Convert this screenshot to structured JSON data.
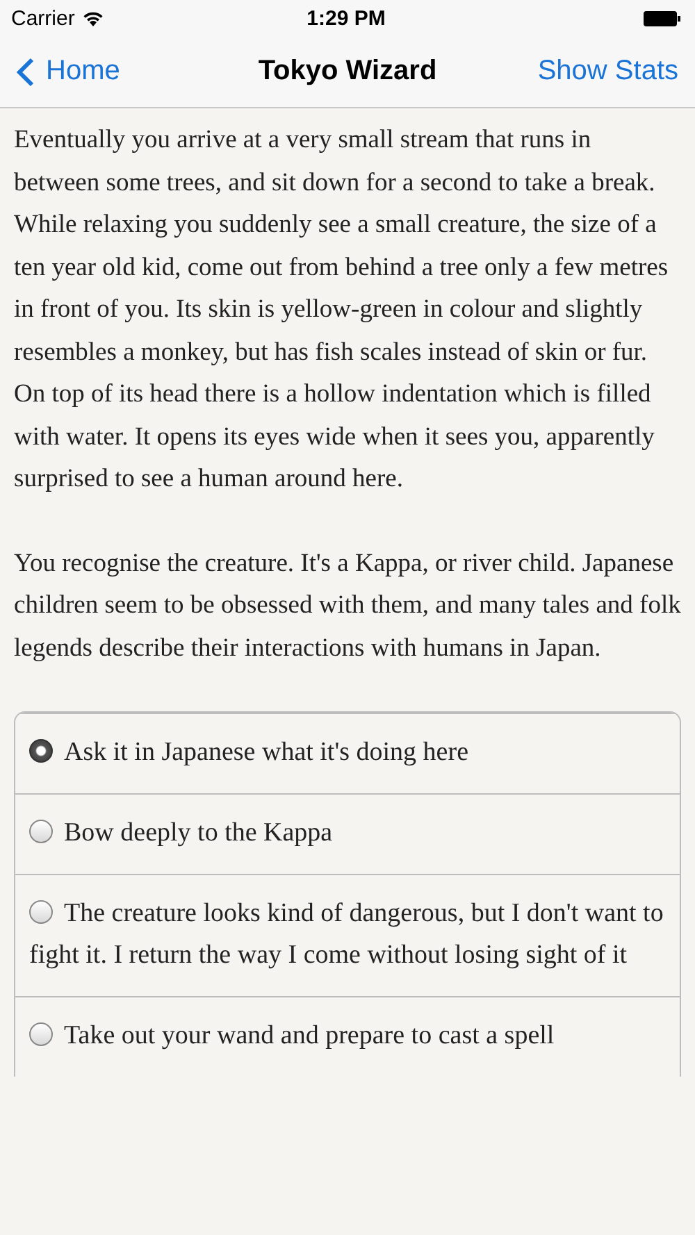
{
  "status_bar": {
    "carrier": "Carrier",
    "time": "1:29 PM"
  },
  "nav_bar": {
    "back": "Home",
    "title": "Tokyo Wizard",
    "action": "Show Stats"
  },
  "story": [
    "Eventually you arrive at a very small stream that runs in between some trees, and sit down for a second to take a break. While relaxing you suddenly see a small creature, the size of a ten year old kid, come out from behind a tree only a few metres in front of you. Its skin is yellow-green in colour and slightly resembles a monkey, but has fish scales instead of skin or fur. On top of its head there is a hollow indentation which is filled with water. It opens its eyes wide when it sees you, apparently surprised to see a human around here.",
    "You recognise the creature. It's a Kappa, or river child. Japanese children seem to be obsessed with them, and many tales and folk legends describe their interactions with humans in Japan."
  ],
  "choices": [
    {
      "label": "Ask it in Japanese what it's doing here",
      "selected": true
    },
    {
      "label": "Bow deeply to the Kappa",
      "selected": false
    },
    {
      "label": "The creature looks kind of dangerous, but I don't want to fight it. I return the way I come without losing sight of it",
      "selected": false
    },
    {
      "label": "Take out your wand and prepare to cast a spell",
      "selected": false
    }
  ]
}
